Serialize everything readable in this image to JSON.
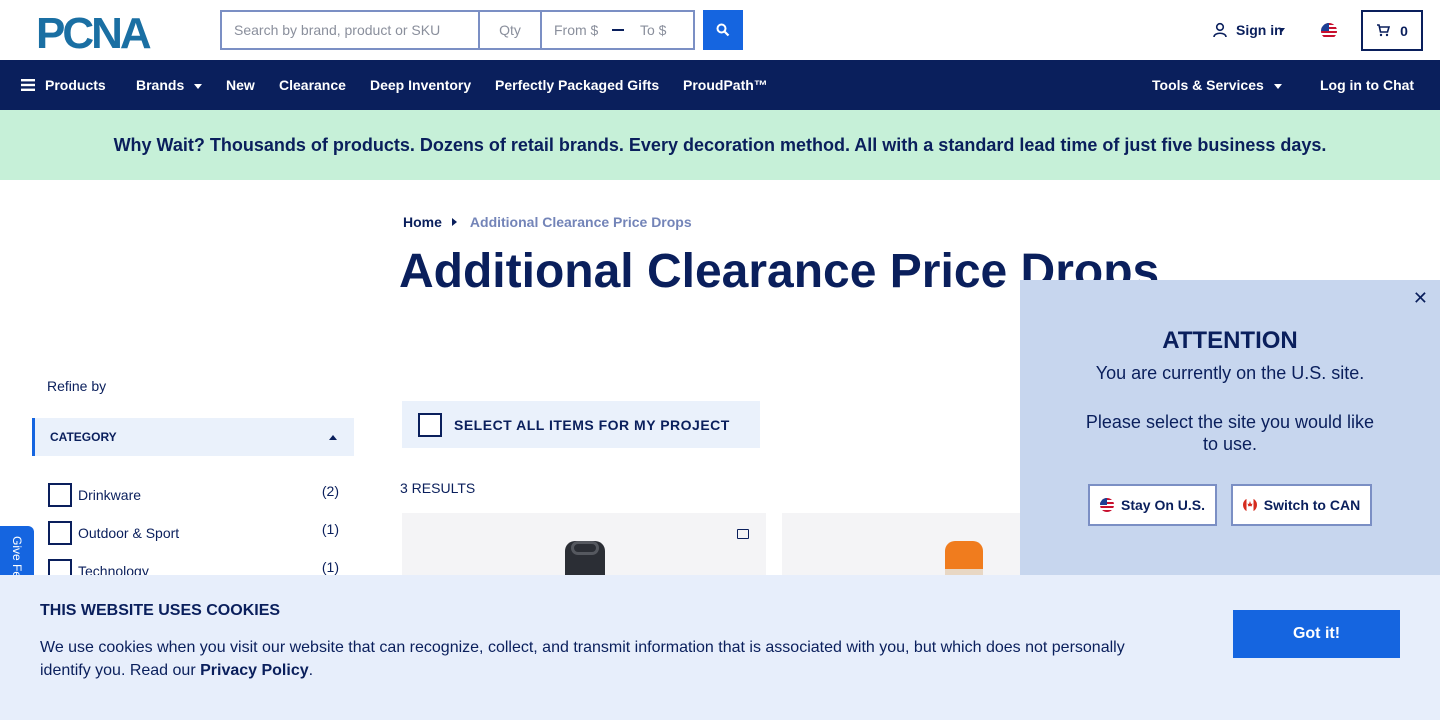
{
  "header": {
    "logo_text": "PCNA",
    "search_placeholder": "Search by brand, product or SKU",
    "qty_placeholder": "Qty",
    "price_from_placeholder": "From $",
    "price_to_placeholder": "To $",
    "signin_label": "Sign in",
    "cart_count": "0"
  },
  "nav": {
    "products": "Products",
    "brands": "Brands",
    "new": "New",
    "clearance": "Clearance",
    "deep_inventory": "Deep Inventory",
    "gifts": "Perfectly Packaged Gifts",
    "proudpath": "ProudPath™",
    "tools": "Tools & Services",
    "chat": "Log in to Chat"
  },
  "banner": {
    "text": "Why Wait? Thousands of products. Dozens of retail brands. Every decoration method. All with a standard lead time of just five business days."
  },
  "breadcrumb": {
    "home": "Home",
    "current": "Additional Clearance Price Drops"
  },
  "page": {
    "title": "Additional Clearance Price Drops",
    "select_all": "SELECT ALL ITEMS FOR MY PROJECT",
    "results": "3 RESULTS"
  },
  "sidebar": {
    "refine_label": "Refine by",
    "category_header": "CATEGORY",
    "categories": [
      {
        "label": "Drinkware",
        "count": "(2)"
      },
      {
        "label": "Outdoor & Sport",
        "count": "(1)"
      },
      {
        "label": "Technology",
        "count": "(1)"
      }
    ],
    "feedback_label": "Give Feedback"
  },
  "modal": {
    "close_glyph": "✕",
    "title": "ATTENTION",
    "line1": "You are currently on the U.S. site.",
    "line2": "Please select the site you would like to use.",
    "stay_label": "Stay On U.S.",
    "switch_label": "Switch to CAN"
  },
  "cookie": {
    "title": "THIS WEBSITE USES COOKIES",
    "text_before": "We use cookies when you visit our website that can recognize, collect, and transmit information that is associated with you, but which does not personally identify you. Read our ",
    "link": "Privacy Policy",
    "text_after": ".",
    "button": "Got it!"
  },
  "colors": {
    "navy": "#0a1f5c",
    "accent_blue": "#1565e0",
    "banner_green": "#c6f0d8",
    "modal_bg": "#c7d6ee",
    "cookie_bg": "#e7eefb"
  }
}
